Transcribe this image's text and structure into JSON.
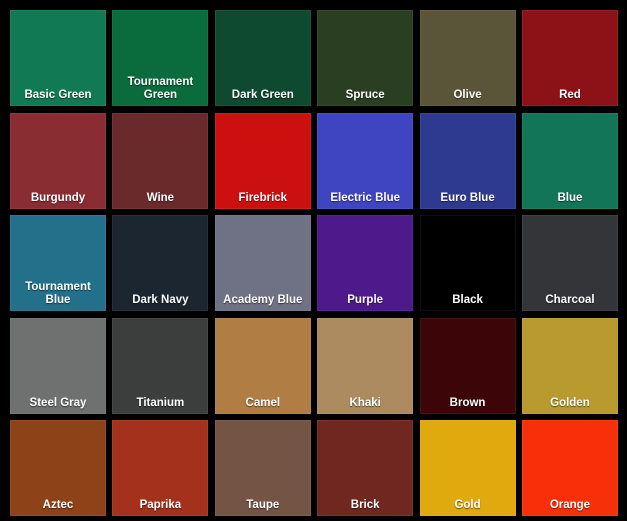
{
  "swatches": [
    {
      "label": "Basic Green",
      "color": "#117a55"
    },
    {
      "label": "Tournament\nGreen",
      "color": "#0a6b3c"
    },
    {
      "label": "Dark Green",
      "color": "#0e4a30"
    },
    {
      "label": "Spruce",
      "color": "#2a3f22"
    },
    {
      "label": "Olive",
      "color": "#5a5538"
    },
    {
      "label": "Red",
      "color": "#8c1217"
    },
    {
      "label": "Burgundy",
      "color": "#892d33"
    },
    {
      "label": "Wine",
      "color": "#6a2a2c"
    },
    {
      "label": "Firebrick",
      "color": "#cc1010"
    },
    {
      "label": "Electric Blue",
      "color": "#3f45c0"
    },
    {
      "label": "Euro Blue",
      "color": "#2e3a8f"
    },
    {
      "label": "Blue",
      "color": "#127558"
    },
    {
      "label": "Tournament\nBlue",
      "color": "#23708a"
    },
    {
      "label": "Dark Navy",
      "color": "#1b2631"
    },
    {
      "label": "Academy Blue",
      "color": "#6f7185"
    },
    {
      "label": "Purple",
      "color": "#4e1a8b"
    },
    {
      "label": "Black",
      "color": "#000000"
    },
    {
      "label": "Charcoal",
      "color": "#333538"
    },
    {
      "label": "Steel Gray",
      "color": "#6f7070"
    },
    {
      "label": "Titanium",
      "color": "#3c3d3d"
    },
    {
      "label": "Camel",
      "color": "#b07d45"
    },
    {
      "label": "Khaki",
      "color": "#ac8b60"
    },
    {
      "label": "Brown",
      "color": "#3c0608"
    },
    {
      "label": "Golden",
      "color": "#b99a2e"
    },
    {
      "label": "Aztec",
      "color": "#8e4218"
    },
    {
      "label": "Paprika",
      "color": "#a3311c"
    },
    {
      "label": "Taupe",
      "color": "#745545"
    },
    {
      "label": "Brick",
      "color": "#70271f"
    },
    {
      "label": "Gold",
      "color": "#e0aa0f"
    },
    {
      "label": "Orange",
      "color": "#f8300a"
    }
  ]
}
